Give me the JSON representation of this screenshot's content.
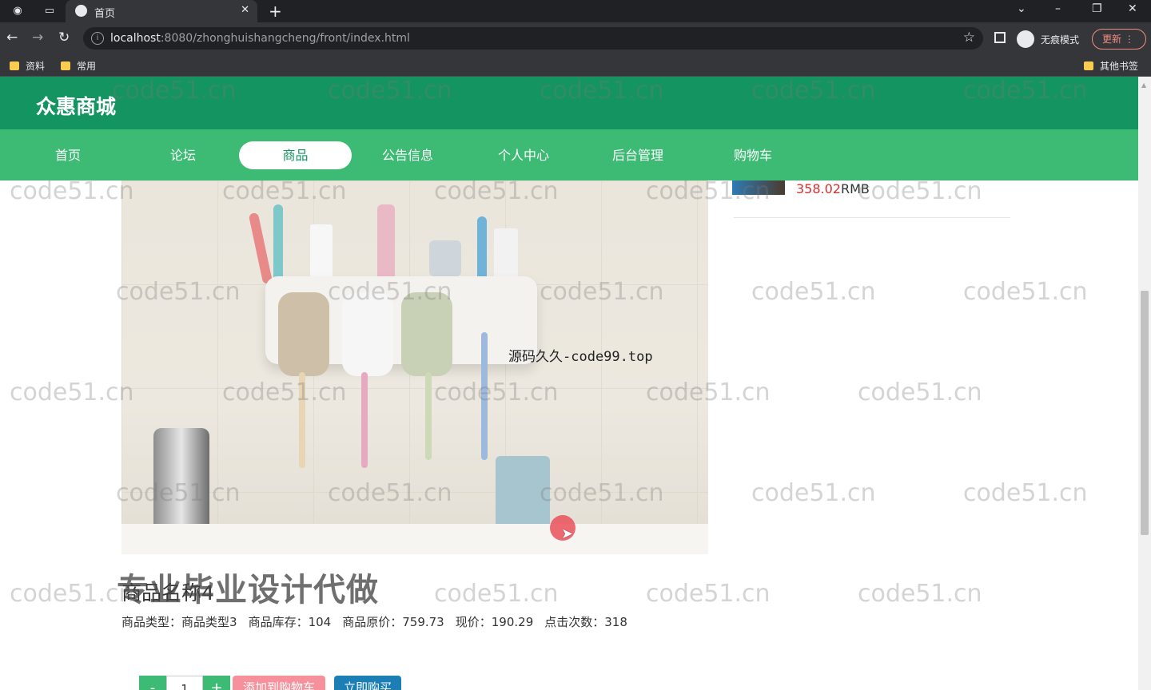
{
  "browser": {
    "tab_title": "首页",
    "url_host": "localhost",
    "url_rest": ":8080/zhonghuishangcheng/front/index.html",
    "incognito_label": "无痕模式",
    "update_label": "更新",
    "bookmarks": [
      "资料",
      "常用"
    ],
    "other_bookmarks": "其他书签"
  },
  "site": {
    "title": "众惠商城",
    "nav": [
      "首页",
      "论坛",
      "商品",
      "公告信息",
      "个人中心",
      "后台管理",
      "购物车"
    ],
    "active_nav": "商品"
  },
  "sidebar": {
    "price": "358.02",
    "unit": "RMB"
  },
  "product": {
    "name": "商品名称4",
    "type_label": "商品类型：",
    "type_value": "商品类型3",
    "stock_label": "商品库存：",
    "stock_value": "104",
    "orig_price_label": "商品原价：",
    "orig_price_value": "759.73",
    "price_label": "现价：",
    "price_value": "190.29",
    "clicks_label": "点击次数：",
    "clicks_value": "318",
    "quantity": "1",
    "minus": "-",
    "plus": "+",
    "add_to_cart": "添加到购物车",
    "buy_now": "立即购买"
  },
  "overlays": {
    "image_text": "源码久久-code99.top",
    "big_watermark": "专业毕业设计代做",
    "watermark": "code51.cn"
  },
  "colors": {
    "header": "#139460",
    "nav": "#3dbb74",
    "price": "#d32f2f",
    "cart_button": "#f6909b",
    "buy_button": "#1b7fb5"
  }
}
